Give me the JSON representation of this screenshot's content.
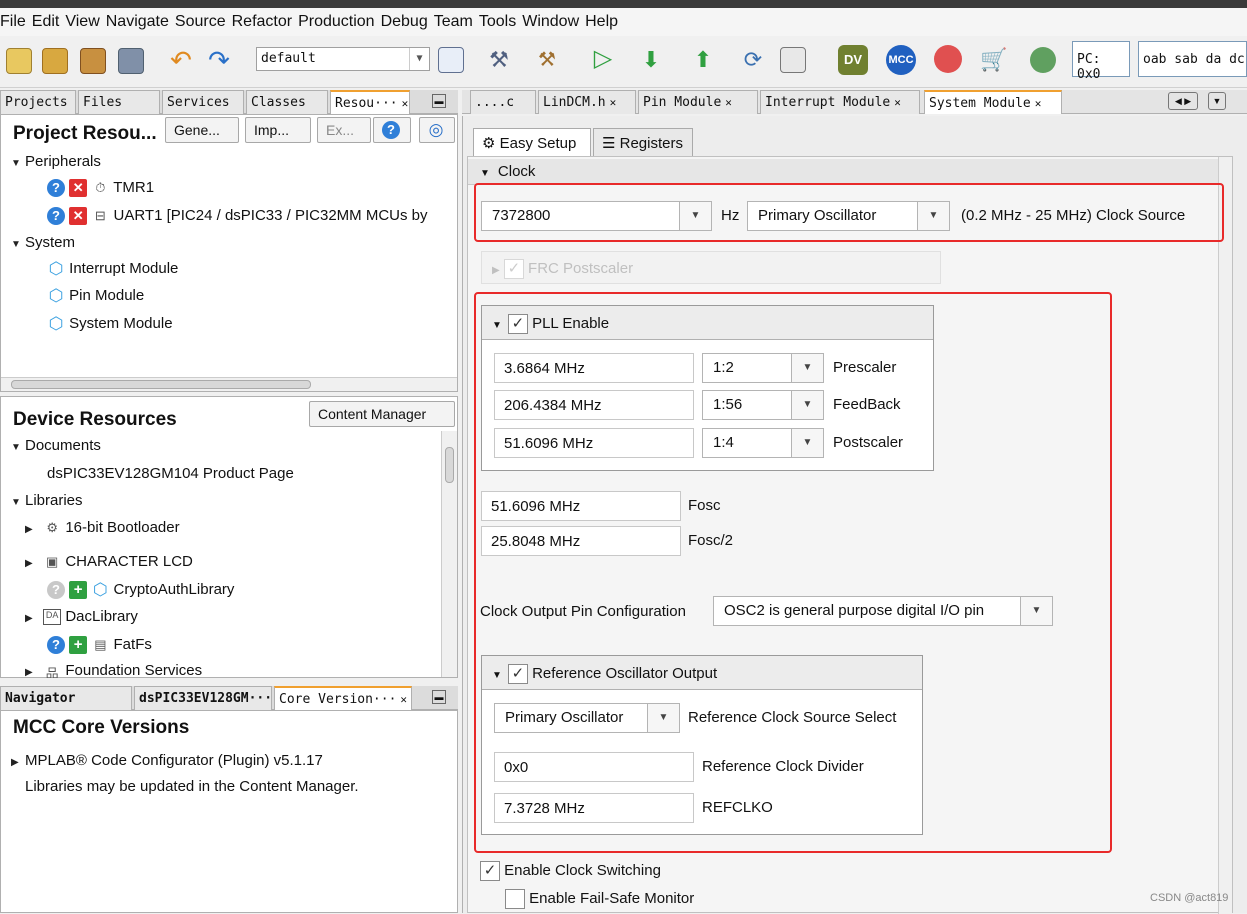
{
  "menu": [
    "File",
    "Edit",
    "View",
    "Navigate",
    "Source",
    "Refactor",
    "Production",
    "Debug",
    "Team",
    "Tools",
    "Window",
    "Help"
  ],
  "toolbar": {
    "config": "default",
    "pc": "PC: 0x0",
    "status": "oab sab da dc"
  },
  "left_tabs": [
    "Projects",
    "Files",
    "Services",
    "Classes",
    "Resou···"
  ],
  "project_resources": {
    "title": "Project Resou...",
    "buttons": [
      "Gene...",
      "Imp...",
      "Ex..."
    ],
    "peripherals_label": "Peripherals",
    "peripherals": [
      "TMR1",
      "UART1 [PIC24 / dsPIC33 / PIC32MM MCUs by"
    ],
    "system_label": "System",
    "system": [
      "Interrupt Module",
      "Pin Module",
      "System Module"
    ]
  },
  "device_resources": {
    "title": "Device Resources",
    "content_manager": "Content Manager",
    "documents_label": "Documents",
    "document": "dsPIC33EV128GM104 Product Page",
    "libraries_label": "Libraries",
    "libraries": [
      "16-bit Bootloader",
      "CHARACTER LCD",
      "CryptoAuthLibrary",
      "DacLibrary",
      "FatFs",
      "Foundation Services"
    ]
  },
  "bottom_tabs": [
    "Navigator",
    "dsPIC33EV128GM···",
    "Core Version···"
  ],
  "core_versions": {
    "title": "MCC Core Versions",
    "plugin": "MPLAB® Code Configurator (Plugin) v5.1.17",
    "note": "Libraries may be updated in the Content Manager."
  },
  "editor_tabs": [
    "....c",
    "LinDCM.h",
    "Pin Module",
    "Interrupt Module",
    "System Module"
  ],
  "subtabs": [
    "Easy Setup",
    "Registers"
  ],
  "clock": {
    "section": "Clock",
    "freq": "7372800",
    "hz": "Hz",
    "source": "Primary Oscillator",
    "range": "(0.2 MHz - 25 MHz) Clock Source",
    "frc_postscaler": "FRC Postscaler"
  },
  "pll": {
    "label": "PLL Enable",
    "rows": [
      {
        "value": "3.6864 MHz",
        "ratio": "1:2",
        "label": "Prescaler"
      },
      {
        "value": "206.4384 MHz",
        "ratio": "1:56",
        "label": "FeedBack"
      },
      {
        "value": "51.6096 MHz",
        "ratio": "1:4",
        "label": "Postscaler"
      }
    ]
  },
  "fosc": {
    "value": "51.6096 MHz",
    "label": "Fosc"
  },
  "fosc2": {
    "value": "25.8048 MHz",
    "label": "Fosc/2"
  },
  "clock_output": {
    "label": "Clock Output Pin Configuration",
    "value": "OSC2 is general purpose digital I/O pin"
  },
  "refosc": {
    "label": "Reference Oscillator Output",
    "source": "Primary Oscillator",
    "source_label": "Reference Clock Source Select",
    "divider": "0x0",
    "divider_label": "Reference Clock Divider",
    "refclko": "7.3728 MHz",
    "refclko_label": "REFCLKO"
  },
  "enable_switching": "Enable Clock Switching",
  "enable_failsafe": "Enable Fail-Safe Monitor",
  "watermark": "CSDN @act819"
}
